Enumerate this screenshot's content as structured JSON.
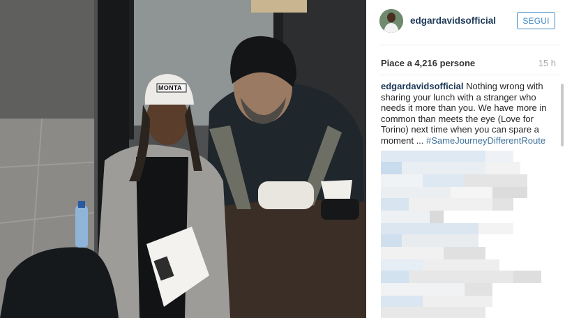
{
  "post": {
    "username": "edgardavidsofficial",
    "follow_label": "SEGUI",
    "likes_text": "Piace a 4,216 persone",
    "time_ago": "15 h",
    "caption": {
      "user": "edgardavidsofficial",
      "text": " Nothing wrong with sharing your lunch with a stranger who needs it more than you. We have more in common than meets the eye (Love for Torino) next time when you can spare a moment ... ",
      "hashtag": "#SameJourneyDifferentRoute"
    },
    "photo": {
      "cap_text": "MONTA"
    }
  },
  "colors": {
    "link": "#3f729b",
    "username": "#1e3a58",
    "follow_button": "#3f88c5",
    "meta_gray": "#a5a7aa"
  },
  "icons": [
    "avatar-image"
  ]
}
